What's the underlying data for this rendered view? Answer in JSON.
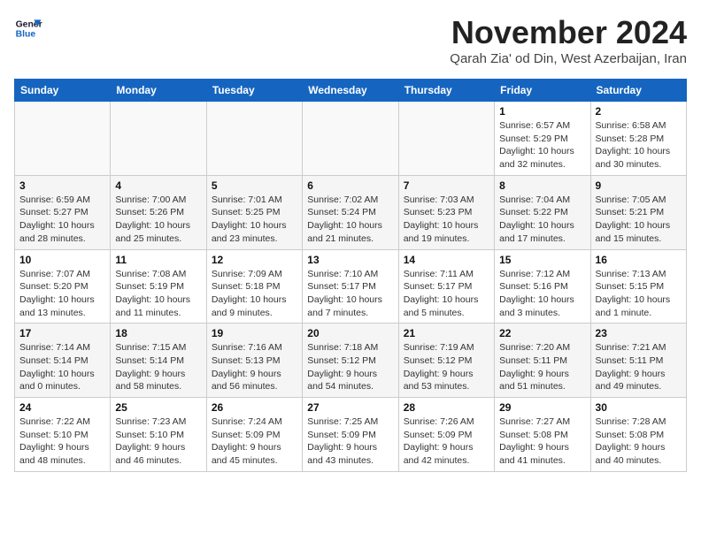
{
  "app": {
    "logo_line1": "General",
    "logo_line2": "Blue"
  },
  "header": {
    "month_year": "November 2024",
    "location": "Qarah Zia' od Din, West Azerbaijan, Iran"
  },
  "weekdays": [
    "Sunday",
    "Monday",
    "Tuesday",
    "Wednesday",
    "Thursday",
    "Friday",
    "Saturday"
  ],
  "weeks": [
    {
      "days": [
        {
          "date": "",
          "info": ""
        },
        {
          "date": "",
          "info": ""
        },
        {
          "date": "",
          "info": ""
        },
        {
          "date": "",
          "info": ""
        },
        {
          "date": "",
          "info": ""
        },
        {
          "date": "1",
          "info": "Sunrise: 6:57 AM\nSunset: 5:29 PM\nDaylight: 10 hours\nand 32 minutes."
        },
        {
          "date": "2",
          "info": "Sunrise: 6:58 AM\nSunset: 5:28 PM\nDaylight: 10 hours\nand 30 minutes."
        }
      ]
    },
    {
      "days": [
        {
          "date": "3",
          "info": "Sunrise: 6:59 AM\nSunset: 5:27 PM\nDaylight: 10 hours\nand 28 minutes."
        },
        {
          "date": "4",
          "info": "Sunrise: 7:00 AM\nSunset: 5:26 PM\nDaylight: 10 hours\nand 25 minutes."
        },
        {
          "date": "5",
          "info": "Sunrise: 7:01 AM\nSunset: 5:25 PM\nDaylight: 10 hours\nand 23 minutes."
        },
        {
          "date": "6",
          "info": "Sunrise: 7:02 AM\nSunset: 5:24 PM\nDaylight: 10 hours\nand 21 minutes."
        },
        {
          "date": "7",
          "info": "Sunrise: 7:03 AM\nSunset: 5:23 PM\nDaylight: 10 hours\nand 19 minutes."
        },
        {
          "date": "8",
          "info": "Sunrise: 7:04 AM\nSunset: 5:22 PM\nDaylight: 10 hours\nand 17 minutes."
        },
        {
          "date": "9",
          "info": "Sunrise: 7:05 AM\nSunset: 5:21 PM\nDaylight: 10 hours\nand 15 minutes."
        }
      ]
    },
    {
      "days": [
        {
          "date": "10",
          "info": "Sunrise: 7:07 AM\nSunset: 5:20 PM\nDaylight: 10 hours\nand 13 minutes."
        },
        {
          "date": "11",
          "info": "Sunrise: 7:08 AM\nSunset: 5:19 PM\nDaylight: 10 hours\nand 11 minutes."
        },
        {
          "date": "12",
          "info": "Sunrise: 7:09 AM\nSunset: 5:18 PM\nDaylight: 10 hours\nand 9 minutes."
        },
        {
          "date": "13",
          "info": "Sunrise: 7:10 AM\nSunset: 5:17 PM\nDaylight: 10 hours\nand 7 minutes."
        },
        {
          "date": "14",
          "info": "Sunrise: 7:11 AM\nSunset: 5:17 PM\nDaylight: 10 hours\nand 5 minutes."
        },
        {
          "date": "15",
          "info": "Sunrise: 7:12 AM\nSunset: 5:16 PM\nDaylight: 10 hours\nand 3 minutes."
        },
        {
          "date": "16",
          "info": "Sunrise: 7:13 AM\nSunset: 5:15 PM\nDaylight: 10 hours\nand 1 minute."
        }
      ]
    },
    {
      "days": [
        {
          "date": "17",
          "info": "Sunrise: 7:14 AM\nSunset: 5:14 PM\nDaylight: 10 hours\nand 0 minutes."
        },
        {
          "date": "18",
          "info": "Sunrise: 7:15 AM\nSunset: 5:14 PM\nDaylight: 9 hours\nand 58 minutes."
        },
        {
          "date": "19",
          "info": "Sunrise: 7:16 AM\nSunset: 5:13 PM\nDaylight: 9 hours\nand 56 minutes."
        },
        {
          "date": "20",
          "info": "Sunrise: 7:18 AM\nSunset: 5:12 PM\nDaylight: 9 hours\nand 54 minutes."
        },
        {
          "date": "21",
          "info": "Sunrise: 7:19 AM\nSunset: 5:12 PM\nDaylight: 9 hours\nand 53 minutes."
        },
        {
          "date": "22",
          "info": "Sunrise: 7:20 AM\nSunset: 5:11 PM\nDaylight: 9 hours\nand 51 minutes."
        },
        {
          "date": "23",
          "info": "Sunrise: 7:21 AM\nSunset: 5:11 PM\nDaylight: 9 hours\nand 49 minutes."
        }
      ]
    },
    {
      "days": [
        {
          "date": "24",
          "info": "Sunrise: 7:22 AM\nSunset: 5:10 PM\nDaylight: 9 hours\nand 48 minutes."
        },
        {
          "date": "25",
          "info": "Sunrise: 7:23 AM\nSunset: 5:10 PM\nDaylight: 9 hours\nand 46 minutes."
        },
        {
          "date": "26",
          "info": "Sunrise: 7:24 AM\nSunset: 5:09 PM\nDaylight: 9 hours\nand 45 minutes."
        },
        {
          "date": "27",
          "info": "Sunrise: 7:25 AM\nSunset: 5:09 PM\nDaylight: 9 hours\nand 43 minutes."
        },
        {
          "date": "28",
          "info": "Sunrise: 7:26 AM\nSunset: 5:09 PM\nDaylight: 9 hours\nand 42 minutes."
        },
        {
          "date": "29",
          "info": "Sunrise: 7:27 AM\nSunset: 5:08 PM\nDaylight: 9 hours\nand 41 minutes."
        },
        {
          "date": "30",
          "info": "Sunrise: 7:28 AM\nSunset: 5:08 PM\nDaylight: 9 hours\nand 40 minutes."
        }
      ]
    }
  ]
}
